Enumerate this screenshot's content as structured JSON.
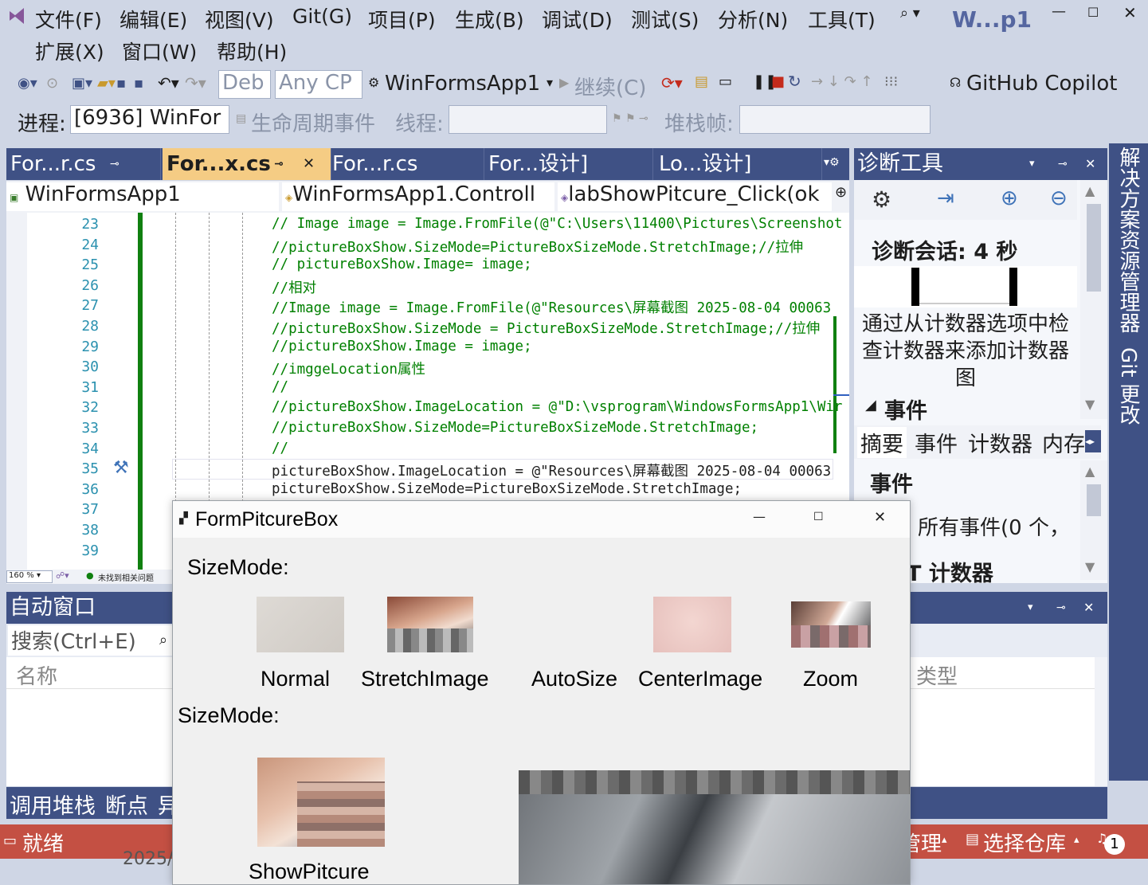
{
  "window": {
    "title": "W...p1"
  },
  "menu": {
    "items": [
      "文件(F)",
      "编辑(E)",
      "视图(V)",
      "Git(G)",
      "项目(P)",
      "生成(B)",
      "调试(D)",
      "测试(S)",
      "分析(N)",
      "工具(T)",
      "扩展(X)",
      "窗口(W)",
      "帮助(H)"
    ]
  },
  "toolbar": {
    "config": "Deb",
    "platform": "Any CP",
    "startup_project": "WinFormsApp1",
    "continue_label": "继续(C)",
    "copilot_label": "GitHub Copilot"
  },
  "debugbar": {
    "process_label": "进程:",
    "process_value": "[6936] WinFor",
    "lifecycle_label": "生命周期事件",
    "thread_label": "线程:",
    "stackframe_label": "堆栈帧:"
  },
  "editor": {
    "tabs": [
      "For...r.cs",
      "For...x.cs",
      "For...r.cs",
      "For...设计]",
      "Lo...设计]"
    ],
    "nav_project": "WinFormsApp1",
    "nav_class": "WinFormsApp1.Controll",
    "nav_member": "labShowPitcure_Click(ok",
    "line_numbers": [
      "23",
      "24",
      "25",
      "26",
      "27",
      "28",
      "29",
      "30",
      "31",
      "32",
      "33",
      "34",
      "35",
      "36",
      "37",
      "38",
      "39"
    ],
    "lines": [
      "// Image image = Image.FromFile(@\"C:\\Users\\11400\\Pictures\\Screenshot",
      "//pictureBoxShow.SizeMode=PictureBoxSizeMode.StretchImage;//拉伸",
      "// pictureBoxShow.Image= image;",
      "//相对",
      "//Image image = Image.FromFile(@\"Resources\\屏幕截图 2025-08-04 00063",
      "//pictureBoxShow.SizeMode = PictureBoxSizeMode.StretchImage;//拉伸",
      "//pictureBoxShow.Image = image;",
      "//imggeLocation属性",
      "//",
      "//pictureBoxShow.ImageLocation = @\"D:\\vsprogram\\WindowsFormsApp1\\Wir",
      "//pictureBoxShow.SizeMode=PictureBoxSizeMode.StretchImage;",
      "//",
      "pictureBoxShow.ImageLocation = @\"Resources\\屏幕截图 2025-08-04 00063",
      "pictureBoxShow.SizeMode=PictureBoxSizeMode.StretchImage;"
    ],
    "zoom": "160 %",
    "issues": "未找到相关问题"
  },
  "diagnostics": {
    "title": "诊断工具",
    "session": "诊断会话: 4 秒",
    "counter_hint": "通过从计数器选项中检查计数器来添加计数器图",
    "events_header": "事件",
    "tabs": [
      "摘要",
      "事件",
      "计数器",
      "内存"
    ],
    "events_section": "事件",
    "all_events": "所有事件(0 个，",
    "counters_section": "T 计数器"
  },
  "right_sidebar": {
    "items": [
      "解决方案资源管理器",
      "Git 更改"
    ]
  },
  "autos": {
    "title": "自动窗口",
    "search_placeholder": "搜索(Ctrl+E)",
    "col_name": "名称",
    "col_type": "类型"
  },
  "bottom_tabs": [
    "调用堆栈",
    "断点",
    "异"
  ],
  "statusbar": {
    "ready": "就绪",
    "manage": "管理",
    "select_repo": "选择仓库",
    "notifications": "1",
    "year_partial": "2025/"
  },
  "form": {
    "title": "FormPitcureBox",
    "label_sizemode1": "SizeMode:",
    "label_sizemode2": "SizeMode:",
    "captions": [
      "Normal",
      "StretchImage",
      "AutoSize",
      "CenterImage",
      "Zoom"
    ],
    "show_caption": "ShowPitcure"
  },
  "colors": {
    "accent": "#3f5185",
    "active_tab": "#f5cc84",
    "statusbar": "#c45043",
    "chrome": "#cfd6e5"
  }
}
